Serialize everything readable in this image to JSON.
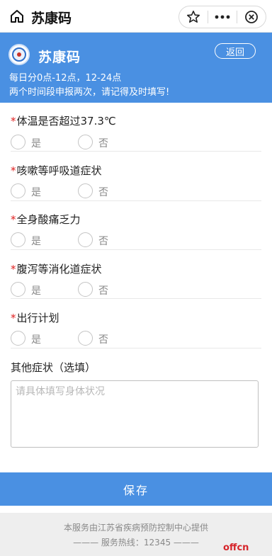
{
  "topbar": {
    "title": "苏康码"
  },
  "header": {
    "brand": "苏康码",
    "back_label": "返回",
    "note_line1": "每日分0点-12点，12-24点",
    "note_line2": "两个时间段申报两次，请记得及时填写!"
  },
  "form": {
    "questions": [
      {
        "required": "*",
        "label": "体温是否超过37.3℃",
        "yes": "是",
        "no": "否"
      },
      {
        "required": "*",
        "label": "咳嗽等呼吸道症状",
        "yes": "是",
        "no": "否"
      },
      {
        "required": "*",
        "label": "全身酸痛乏力",
        "yes": "是",
        "no": "否"
      },
      {
        "required": "*",
        "label": "腹泻等消化道症状",
        "yes": "是",
        "no": "否"
      },
      {
        "required": "*",
        "label": "出行计划",
        "yes": "是",
        "no": "否"
      }
    ],
    "other": {
      "label": "其他症状（选填）",
      "placeholder": "请具体填写身体状况",
      "value": ""
    },
    "save_label": "保存"
  },
  "footer": {
    "line1": "本服务由江苏省疾病预防控制中心提供",
    "line2": "——— 服务热线：12345 ———"
  },
  "watermark": "offcn",
  "colors": {
    "brand_blue": "#4a90e2",
    "required_red": "#e02020",
    "footer_bg": "#eeeeee"
  }
}
